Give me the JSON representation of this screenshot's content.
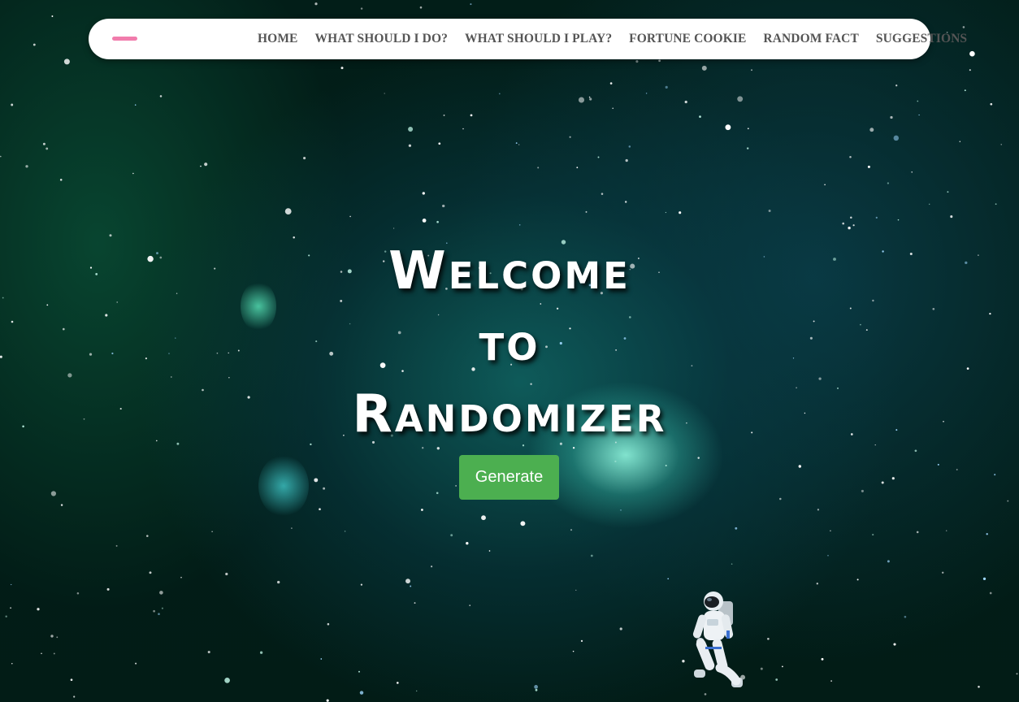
{
  "nav": {
    "links": [
      "HOME",
      "WHAT SHOULD I DO?",
      "WHAT SHOULD I PLAY?",
      "FORTUNE COOKIE",
      "RANDOM FACT",
      "SUGGESTIONS"
    ]
  },
  "hero": {
    "title_lines": [
      "Welcome",
      "to",
      "Randomizer"
    ],
    "button_label": "Generate"
  },
  "colors": {
    "navbar_bg": "#ffffff",
    "menu_toggle": "#f17cac",
    "nav_text": "#555555",
    "button_bg": "#4caf50",
    "title_text": "#ffffff"
  },
  "icons": {
    "menu": "hamburger-menu-icon",
    "astronaut": "astronaut-image"
  }
}
